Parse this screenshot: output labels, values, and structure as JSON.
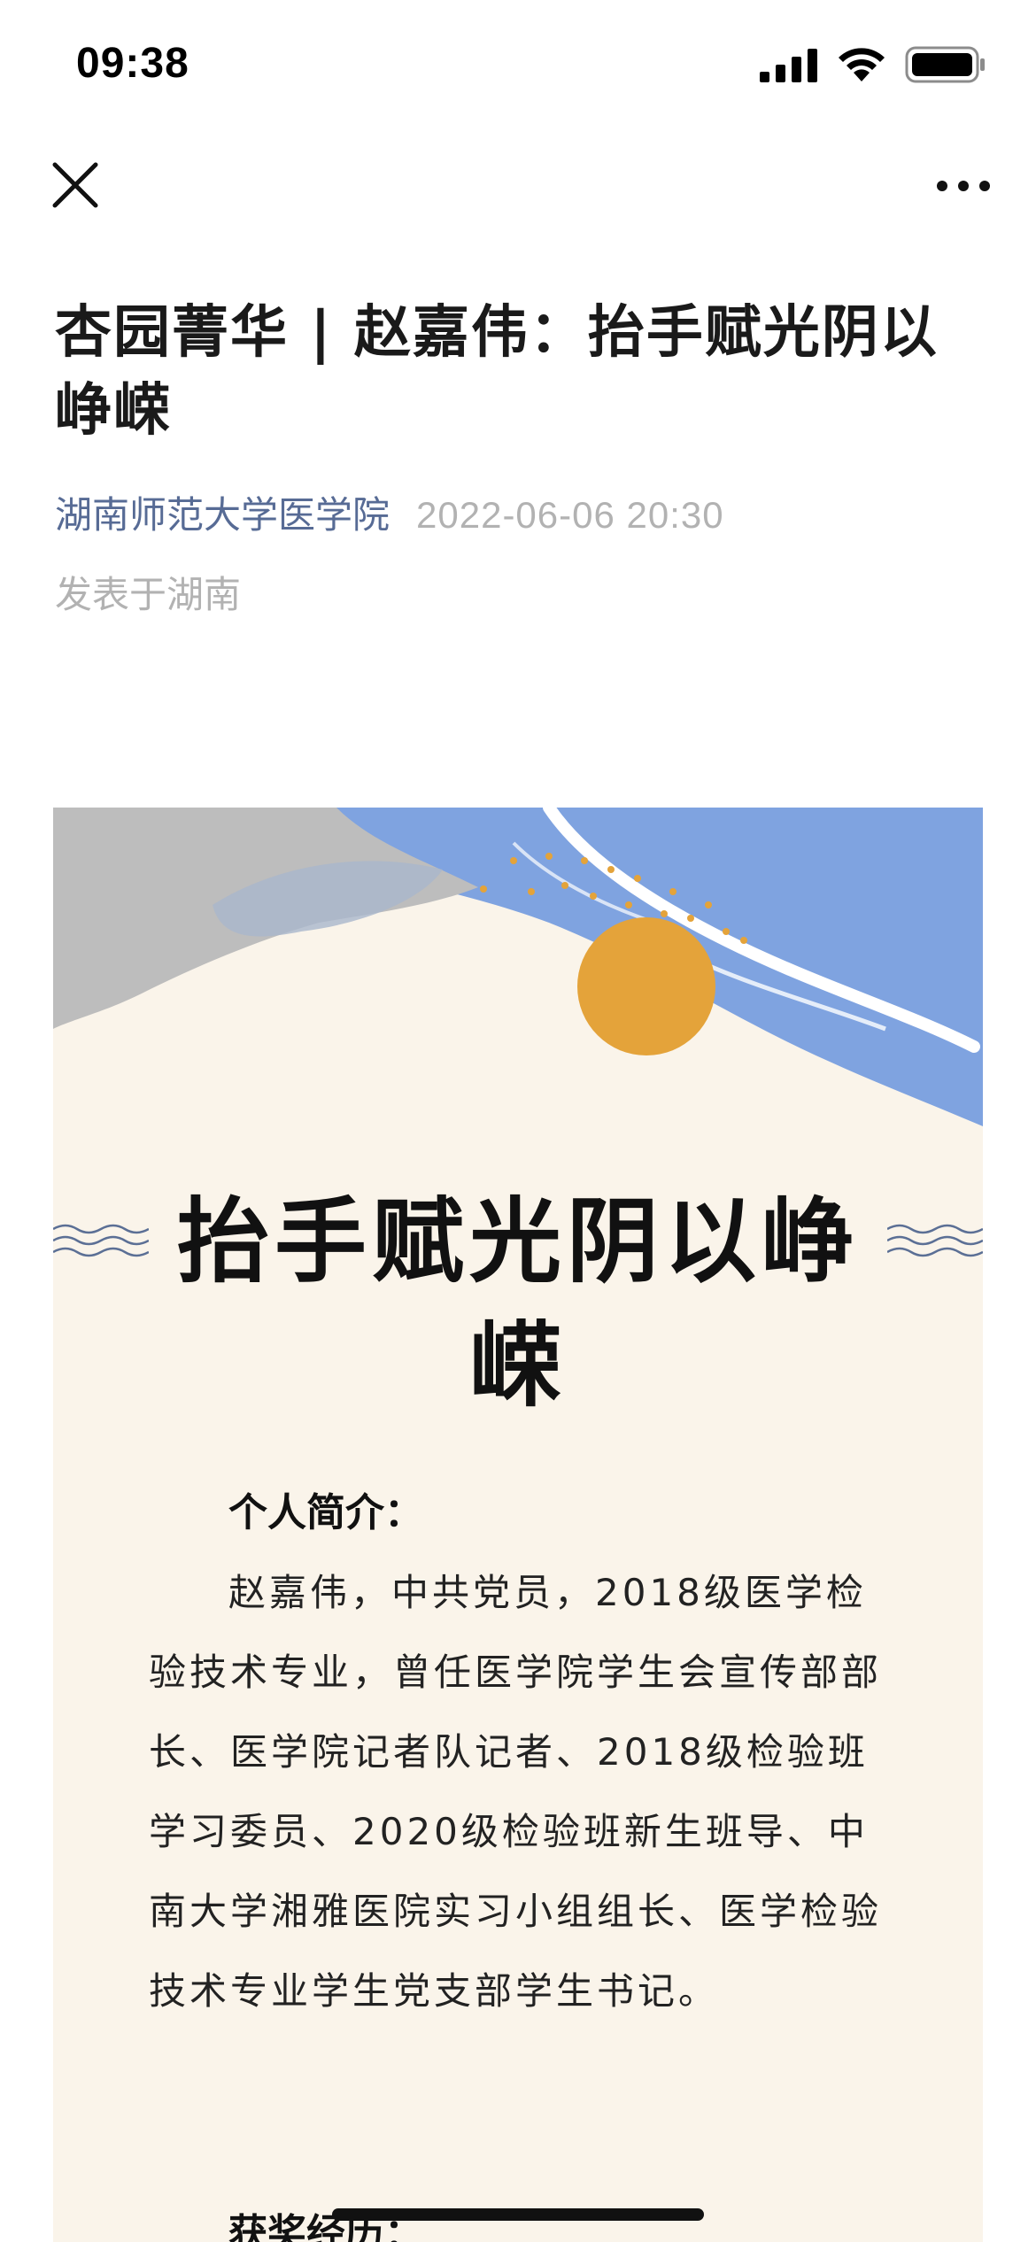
{
  "status_bar": {
    "time": "09:38"
  },
  "article": {
    "title": "杏园菁华 | 赵嘉伟：抬手赋光阴以峥嵘",
    "author": "湖南师范大学医学院",
    "date": "2022-06-06 20:30",
    "location": "发表于湖南"
  },
  "poster": {
    "heading": "抬手赋光阴以峥嵘",
    "section1_label": "个人简介：",
    "section1_body": "赵嘉伟，中共党员，2018级医学检验技术专业，曾任医学院学生会宣传部部长、医学院记者队记者、2018级检验班学习委员、2020级检验班新生班导、中南大学湘雅医院实习小组组长、医学检验技术专业学生党支部学生书记。",
    "section2_label": "获奖经历：",
    "colors": {
      "cream": "#faf4ea",
      "blue": "#7fa3e0",
      "gray": "#bdbdbd",
      "sun": "#e4a33a"
    }
  }
}
